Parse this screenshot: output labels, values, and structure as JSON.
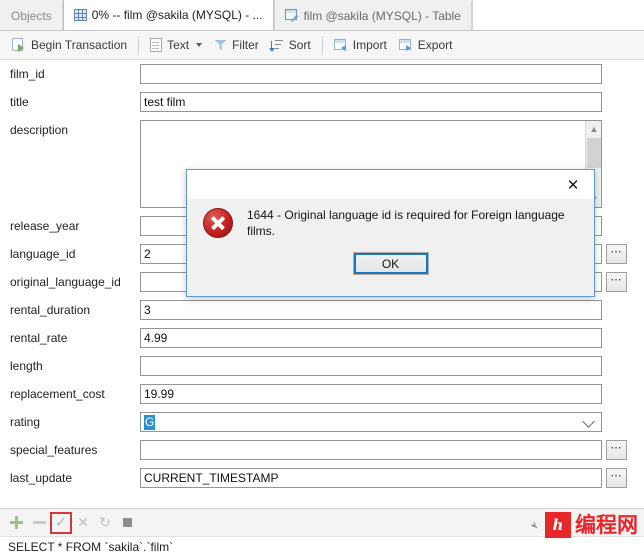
{
  "tabs": [
    {
      "label": "Objects",
      "icon": "none",
      "state": "inactive"
    },
    {
      "label": "0% -- film @sakila (MYSQL) - ...",
      "icon": "grid-icon",
      "state": "active"
    },
    {
      "label": "film @sakila (MYSQL) - Table",
      "icon": "table-edit-icon",
      "state": "inactive"
    }
  ],
  "toolbar": {
    "begin_transaction": "Begin Transaction",
    "text": "Text",
    "filter": "Filter",
    "sort": "Sort",
    "import": "Import",
    "export": "Export"
  },
  "form": {
    "fields": [
      {
        "label": "film_id",
        "value": "",
        "type": "text",
        "dots": false
      },
      {
        "label": "title",
        "value": "test film",
        "type": "text",
        "dots": false
      },
      {
        "label": "description",
        "value": "",
        "type": "textarea",
        "dots": false
      },
      {
        "label": "release_year",
        "value": "",
        "type": "text",
        "dots": false
      },
      {
        "label": "language_id",
        "value": "2",
        "type": "text",
        "dots": true
      },
      {
        "label": "original_language_id",
        "value": "",
        "type": "text",
        "dots": true
      },
      {
        "label": "rental_duration",
        "value": "3",
        "type": "text",
        "dots": false
      },
      {
        "label": "rental_rate",
        "value": "4.99",
        "type": "text",
        "dots": false
      },
      {
        "label": "length",
        "value": "",
        "type": "text",
        "dots": false
      },
      {
        "label": "replacement_cost",
        "value": "19.99",
        "type": "text",
        "dots": false
      },
      {
        "label": "rating",
        "value": "G",
        "type": "combo",
        "dots": false
      },
      {
        "label": "special_features",
        "value": "",
        "type": "text",
        "dots": true
      },
      {
        "label": "last_update",
        "value": "CURRENT_TIMESTAMP",
        "type": "text",
        "dots": true
      }
    ]
  },
  "record_nav": {
    "add_icon": "plus-icon",
    "remove_icon": "minus-icon",
    "confirm_icon": "check-icon",
    "cancel_icon": "close-icon",
    "refresh_icon": "refresh-icon",
    "stop_icon": "stop-icon",
    "highlight_color": "#d0393e"
  },
  "status": {
    "query": "SELECT * FROM `sakila`.`film`"
  },
  "dialog": {
    "close_icon": "close-icon",
    "error_icon": "error-icon",
    "message": "1644 - Original language id is required for Foreign language films.",
    "ok_label": "OK",
    "accent_color": "#1e76b8"
  },
  "watermark": {
    "pin_icon": "pin-icon",
    "logo_glyph": "h",
    "text": "编程网",
    "color": "#e8272b"
  }
}
